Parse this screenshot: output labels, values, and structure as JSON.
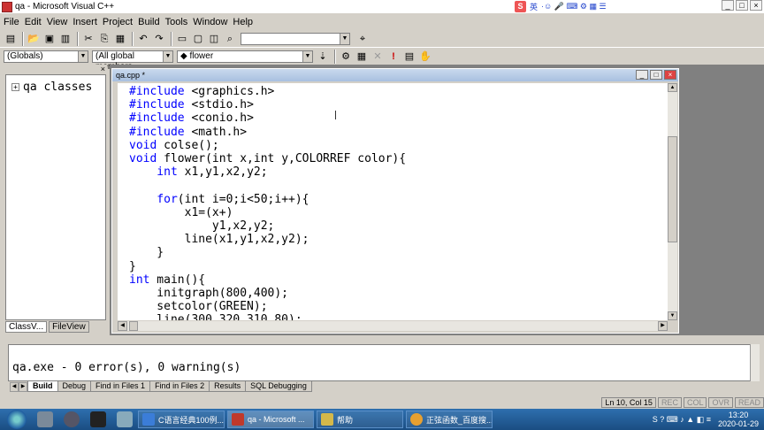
{
  "window": {
    "title": "qa - Microsoft Visual C++"
  },
  "ime": {
    "brand": "S",
    "lang": "英",
    "extra": "·☺ 🎤 ⌨ ⚙ ▦ ☰"
  },
  "menu": [
    "File",
    "Edit",
    "View",
    "Insert",
    "Project",
    "Build",
    "Tools",
    "Window",
    "Help"
  ],
  "toolbar2": {
    "scope": "(Globals)",
    "members": "(All global members",
    "function": "◆ flower"
  },
  "classview": {
    "root": "qa classes",
    "tabs": [
      "ClassV...",
      "FileView"
    ]
  },
  "document": {
    "title": "qa.cpp *",
    "lines": [
      {
        "kw": "#include",
        "rest": " <graphics.h>"
      },
      {
        "kw": "#include",
        "rest": " <stdio.h>"
      },
      {
        "kw": "#include",
        "rest": " <conio.h>"
      },
      {
        "kw": "#include",
        "rest": " <math.h>"
      },
      {
        "kw": "void",
        "rest": " colse();"
      },
      {
        "kw": "void",
        "rest": " flower(int x,int y,COLORREF color){"
      },
      {
        "kw": "    int",
        "rest": " x1,y1,x2,y2;"
      },
      {
        "kw": "",
        "rest": ""
      },
      {
        "kw": "    for",
        "rest": "(int i=0;i<50;i++){"
      },
      {
        "kw": "",
        "rest": "        x1=(x+)"
      },
      {
        "kw": "",
        "rest": "            y1,x2,y2;"
      },
      {
        "kw": "",
        "rest": "        line(x1,y1,x2,y2);"
      },
      {
        "kw": "",
        "rest": "    }"
      },
      {
        "kw": "",
        "rest": "}"
      },
      {
        "kw": "int",
        "rest": " main(){"
      },
      {
        "kw": "",
        "rest": "    initgraph(800,400);"
      },
      {
        "kw": "",
        "rest": "    setcolor(GREEN);"
      },
      {
        "kw": "",
        "rest": "    line(300,320,310,80);"
      }
    ]
  },
  "output": {
    "message": "qa.exe - 0 error(s), 0 warning(s)",
    "tabs": [
      "Build",
      "Debug",
      "Find in Files 1",
      "Find in Files 2",
      "Results",
      "SQL Debugging"
    ]
  },
  "status": {
    "position": "Ln 10, Col 15",
    "flags": [
      "REC",
      "COL",
      "OVR",
      "READ"
    ]
  },
  "taskbar": {
    "tasks": [
      {
        "label": "C语言经典100例...",
        "color": "#3b7dd8"
      },
      {
        "label": "qa - Microsoft ...",
        "color": "#c0392b"
      },
      {
        "label": "帮助",
        "color": "#d4b84a"
      },
      {
        "label": "正弦函数_百度搜...",
        "color": "#e8a030"
      }
    ],
    "time": "13:20",
    "date": "2020-01-29"
  }
}
